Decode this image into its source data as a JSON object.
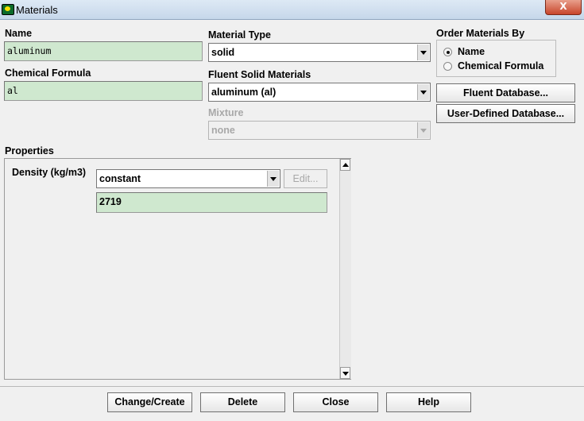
{
  "window": {
    "title": "Materials",
    "close_glyph": "X"
  },
  "name": {
    "label": "Name",
    "value": "aluminum"
  },
  "chemical_formula": {
    "label": "Chemical Formula",
    "value": "al"
  },
  "material_type": {
    "label": "Material Type",
    "value": "solid"
  },
  "fluent_solid_materials": {
    "label": "Fluent Solid Materials",
    "value": "aluminum (al)"
  },
  "mixture": {
    "label": "Mixture",
    "value": "none",
    "enabled": false
  },
  "order_by": {
    "label": "Order Materials By",
    "options": [
      {
        "label": "Name",
        "selected": true
      },
      {
        "label": "Chemical Formula",
        "selected": false
      }
    ]
  },
  "database_buttons": {
    "fluent": "Fluent Database...",
    "user_defined": "User-Defined Database..."
  },
  "properties": {
    "label": "Properties",
    "density": {
      "label": "Density (kg/m3)",
      "method": "constant",
      "edit_label": "Edit...",
      "value": "2719"
    }
  },
  "footer": {
    "change_create": "Change/Create",
    "delete": "Delete",
    "close": "Close",
    "help": "Help"
  }
}
